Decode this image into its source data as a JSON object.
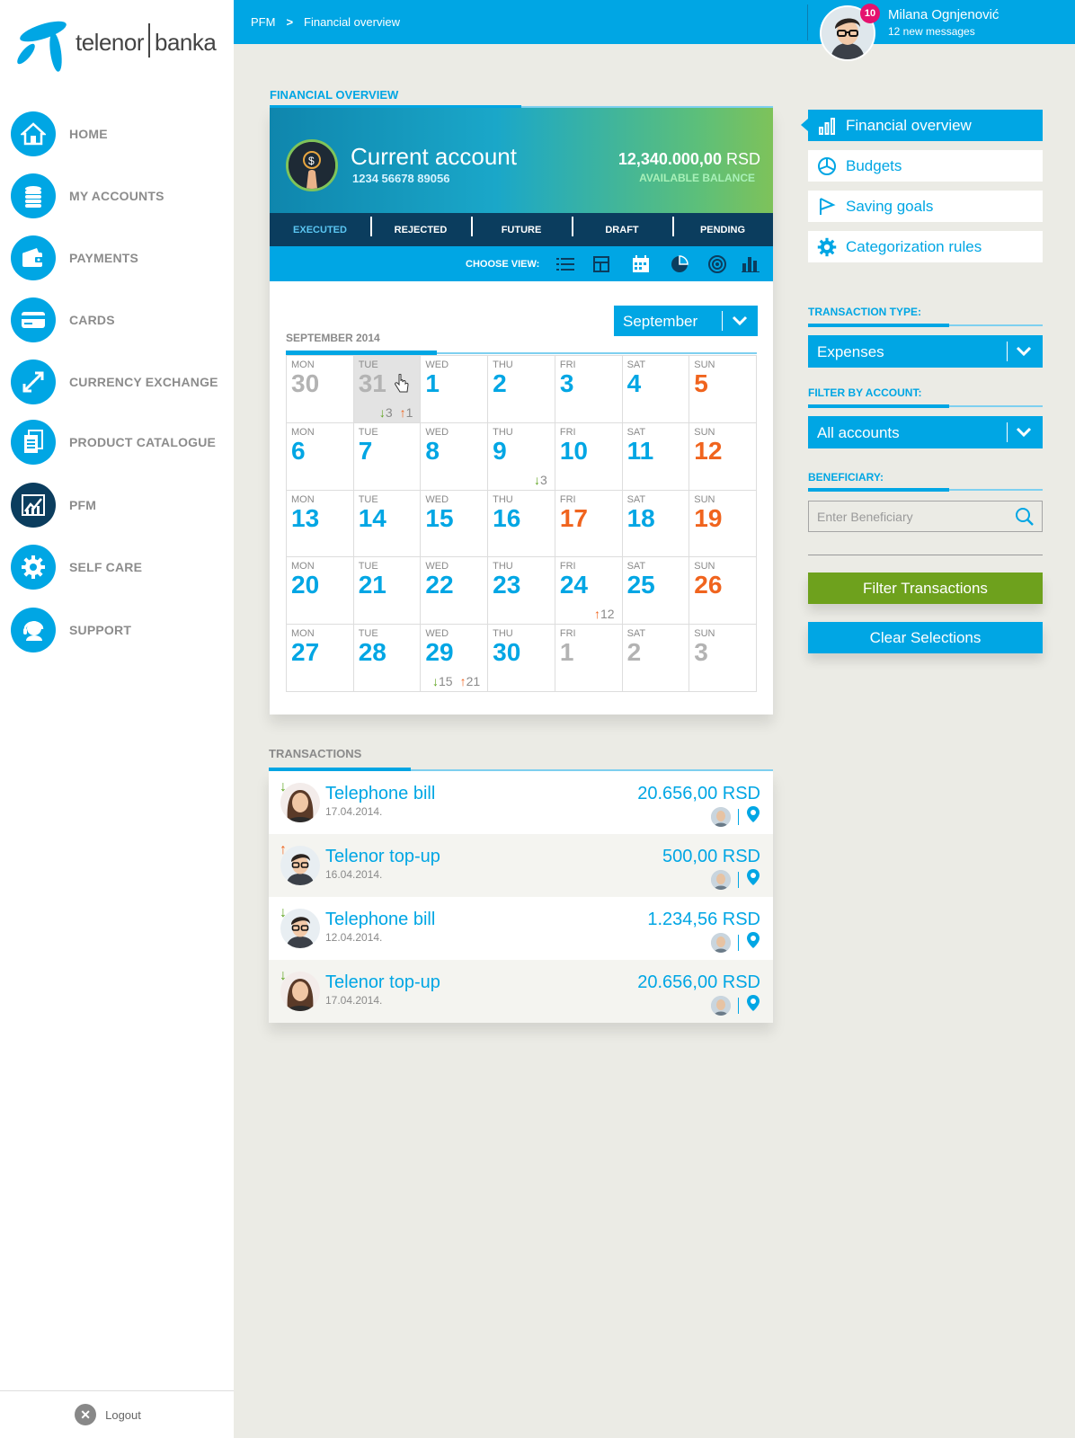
{
  "brand": {
    "name_left": "telenor",
    "name_right": "banka",
    "color": "#00a6e4"
  },
  "nav": {
    "items": [
      {
        "label": "HOME",
        "icon": "home-icon"
      },
      {
        "label": "MY ACCOUNTS",
        "icon": "coins-icon"
      },
      {
        "label": "PAYMENTS",
        "icon": "wallet-icon"
      },
      {
        "label": "CARDS",
        "icon": "card-icon"
      },
      {
        "label": "CURRENCY EXCHANGE",
        "icon": "exchange-icon"
      },
      {
        "label": "PRODUCT CATALOGUE",
        "icon": "catalogue-icon"
      },
      {
        "label": "PFM",
        "icon": "chart-icon",
        "active": true
      },
      {
        "label": "SELF CARE",
        "icon": "gear-icon"
      },
      {
        "label": "SUPPORT",
        "icon": "support-icon"
      }
    ],
    "logout": "Logout"
  },
  "topbar": {
    "breadcrumb": [
      "PFM",
      "Financial overview"
    ],
    "user_name": "Milana Ognjenović",
    "messages": "12 new messages",
    "badge": "10"
  },
  "overview": {
    "section_title": "FINANCIAL OVERVIEW",
    "account_title": "Current account",
    "account_number": "1234 56678 89056",
    "balance": "12,340.000,00",
    "currency": "RSD",
    "balance_label": "AVAILABLE BALANCE",
    "tabs": [
      "EXECUTED",
      "REJECTED",
      "FUTURE",
      "DRAFT",
      "PENDING"
    ],
    "active_tab": "EXECUTED",
    "choose_view": "CHOOSE VIEW:",
    "views": [
      "list-view-icon",
      "grid-view-icon",
      "calendar-view-icon",
      "pie-view-icon",
      "target-view-icon",
      "bar-view-icon"
    ],
    "month": "September",
    "calendar_title": "SEPTEMBER 2014"
  },
  "calendar": [
    {
      "day": "MON",
      "num": "30",
      "style": "gray"
    },
    {
      "day": "TUE",
      "num": "31",
      "style": "gray",
      "selected": true,
      "down": "3",
      "up": "1"
    },
    {
      "day": "WED",
      "num": "1"
    },
    {
      "day": "THU",
      "num": "2"
    },
    {
      "day": "FRI",
      "num": "3"
    },
    {
      "day": "SAT",
      "num": "4"
    },
    {
      "day": "SUN",
      "num": "5",
      "style": "sun"
    },
    {
      "day": "MON",
      "num": "6"
    },
    {
      "day": "TUE",
      "num": "7"
    },
    {
      "day": "WED",
      "num": "8"
    },
    {
      "day": "THU",
      "num": "9",
      "down": "3"
    },
    {
      "day": "FRI",
      "num": "10"
    },
    {
      "day": "SAT",
      "num": "11"
    },
    {
      "day": "SUN",
      "num": "12",
      "style": "sun"
    },
    {
      "day": "MON",
      "num": "13"
    },
    {
      "day": "TUE",
      "num": "14"
    },
    {
      "day": "WED",
      "num": "15"
    },
    {
      "day": "THU",
      "num": "16"
    },
    {
      "day": "FRI",
      "num": "17",
      "style": "sun"
    },
    {
      "day": "SAT",
      "num": "18"
    },
    {
      "day": "SUN",
      "num": "19",
      "style": "sun"
    },
    {
      "day": "MON",
      "num": "20"
    },
    {
      "day": "TUE",
      "num": "21"
    },
    {
      "day": "WED",
      "num": "22"
    },
    {
      "day": "THU",
      "num": "23"
    },
    {
      "day": "FRI",
      "num": "24",
      "up": "12"
    },
    {
      "day": "SAT",
      "num": "25"
    },
    {
      "day": "SUN",
      "num": "26",
      "style": "sun"
    },
    {
      "day": "MON",
      "num": "27"
    },
    {
      "day": "TUE",
      "num": "28"
    },
    {
      "day": "WED",
      "num": "29",
      "down": "15",
      "up": "21"
    },
    {
      "day": "THU",
      "num": "30"
    },
    {
      "day": "FRI",
      "num": "1",
      "style": "gray"
    },
    {
      "day": "SAT",
      "num": "2",
      "style": "gray"
    },
    {
      "day": "SUN",
      "num": "3",
      "style": "gray"
    }
  ],
  "transactions": {
    "title": "TRANSACTIONS",
    "rows": [
      {
        "name": "Telephone bill",
        "date": "17.04.2014.",
        "amount": "20.656,00 RSD",
        "direction": "down",
        "avatar": "female"
      },
      {
        "name": "Telenor top-up",
        "date": "16.04.2014.",
        "amount": "500,00 RSD",
        "direction": "up",
        "avatar": "male"
      },
      {
        "name": "Telephone bill",
        "date": "12.04.2014.",
        "amount": "1.234,56 RSD",
        "direction": "down",
        "avatar": "male"
      },
      {
        "name": "Telenor top-up",
        "date": "17.04.2014.",
        "amount": "20.656,00 RSD",
        "direction": "down",
        "avatar": "female"
      }
    ]
  },
  "right": {
    "menu": [
      {
        "label": "Financial overview",
        "icon": "bar-chart-icon",
        "active": true
      },
      {
        "label": "Budgets",
        "icon": "pie-chart-icon"
      },
      {
        "label": "Saving goals",
        "icon": "flag-icon"
      },
      {
        "label": "Categorization rules",
        "icon": "gear-icon"
      }
    ],
    "type_label": "TRANSACTION TYPE:",
    "type_value": "Expenses",
    "account_label": "FILTER BY ACCOUNT:",
    "account_value": "All accounts",
    "beneficiary_label": "BENEFICIARY:",
    "beneficiary_placeholder": "Enter Beneficiary",
    "filter_btn": "Filter Transactions",
    "clear_btn": "Clear Selections"
  },
  "colors": {
    "accent": "#00a6e4",
    "navy": "#0b3d5e",
    "orange": "#f0641e",
    "green": "#6ea11d"
  }
}
